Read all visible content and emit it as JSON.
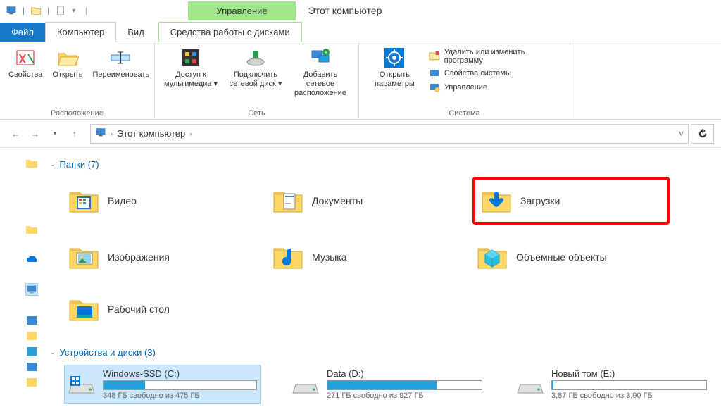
{
  "title": "Этот компьютер",
  "manage_tab": "Управление",
  "menu": {
    "file": "Файл",
    "computer": "Компьютер",
    "view": "Вид",
    "tools": "Средства работы с дисками"
  },
  "ribbon": {
    "group_location": "Расположение",
    "properties": "Свойства",
    "open": "Открыть",
    "rename": "Переименовать",
    "group_network": "Сеть",
    "media_access": "Доступ к мультимедиа",
    "map_drive": "Подключить сетевой диск",
    "add_net_location": "Добавить сетевое расположение",
    "group_system": "Система",
    "open_settings": "Открыть параметры",
    "uninstall": "Удалить или изменить программу",
    "sys_props": "Свойства системы",
    "manage": "Управление"
  },
  "breadcrumb": "Этот компьютер",
  "sections": {
    "folders": "Папки (7)",
    "drives": "Устройства и диски (3)"
  },
  "folders": [
    {
      "label": "Видео",
      "icon": "video"
    },
    {
      "label": "Документы",
      "icon": "docs"
    },
    {
      "label": "Загрузки",
      "icon": "downloads",
      "highlight": true
    },
    {
      "label": "Изображения",
      "icon": "pictures"
    },
    {
      "label": "Музыка",
      "icon": "music"
    },
    {
      "label": "Объемные объекты",
      "icon": "3d"
    },
    {
      "label": "Рабочий стол",
      "icon": "desktop"
    }
  ],
  "drives_list": [
    {
      "name": "Windows-SSD (C:)",
      "free": "348 ГБ свободно из 475 ГБ",
      "fill_pct": 27,
      "selected": true,
      "os": true
    },
    {
      "name": "Data (D:)",
      "free": "271 ГБ свободно из 927 ГБ",
      "fill_pct": 71,
      "selected": false,
      "os": false
    },
    {
      "name": "Новый том (E:)",
      "free": "3,87 ГБ свободно из 3,90 ГБ",
      "fill_pct": 1,
      "selected": false,
      "os": false
    }
  ]
}
